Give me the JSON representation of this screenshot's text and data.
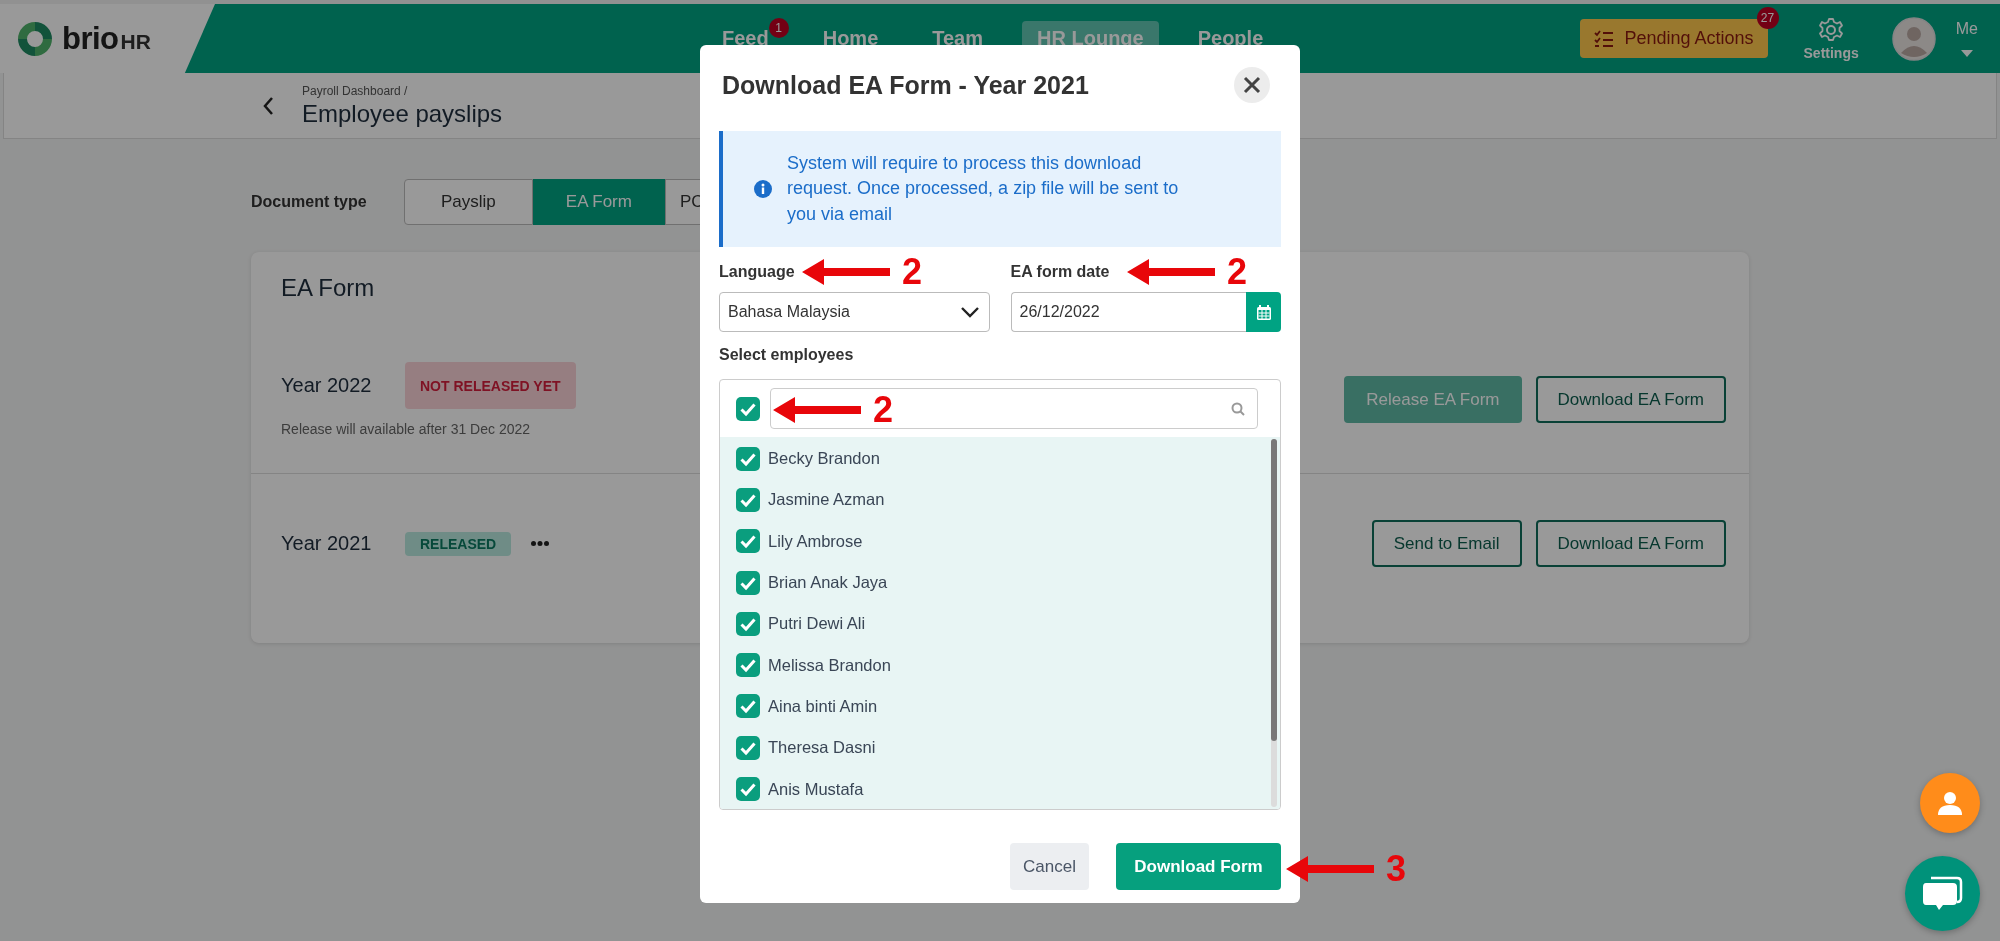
{
  "header": {
    "logo": {
      "name": "brio",
      "suffix": "HR"
    },
    "nav": [
      {
        "label": "Feed",
        "badge": "1",
        "selected": false
      },
      {
        "label": "Home",
        "selected": false
      },
      {
        "label": "Team",
        "selected": false
      },
      {
        "label": "HR Lounge",
        "selected": true
      },
      {
        "label": "People",
        "selected": false
      }
    ],
    "pending_actions": {
      "label": "Pending Actions",
      "badge": "27"
    },
    "settings": {
      "label": "Settings"
    },
    "user": {
      "label": "Me"
    }
  },
  "breadcrumb": {
    "parent": "Payroll Dashboard /",
    "title": "Employee payslips"
  },
  "document_type": {
    "label": "Document type",
    "tabs": [
      {
        "label": "Payslip",
        "selected": false
      },
      {
        "label": "EA Form",
        "selected": true
      },
      {
        "label": "PC",
        "selected": false
      }
    ]
  },
  "card": {
    "title": "EA Form",
    "rows": [
      {
        "year": "Year 2022",
        "status": "NOT RELEASED YET",
        "kind": "pending",
        "note": "Release will available after 31 Dec 2022",
        "has_menu": false,
        "buttons": [
          {
            "label": "Release EA Form",
            "kind": "filled",
            "disabled": true
          },
          {
            "label": "Download EA Form",
            "kind": "outline",
            "disabled": false
          }
        ]
      },
      {
        "year": "Year 2021",
        "status": "RELEASED",
        "kind": "released",
        "has_menu": true,
        "buttons": [
          {
            "label": "Send to Email",
            "kind": "outline",
            "disabled": false
          },
          {
            "label": "Download EA Form",
            "kind": "outline",
            "disabled": false
          }
        ]
      }
    ]
  },
  "modal": {
    "title": "Download EA Form - Year 2021",
    "info": "System will require to process this download request. Once processed, a zip file will be sent to you via email",
    "language": {
      "label": "Language",
      "value": "Bahasa Malaysia",
      "annotation": "2"
    },
    "date": {
      "label": "EA form date",
      "value": "26/12/2022",
      "annotation": "2"
    },
    "employees": {
      "label": "Select employees",
      "select_all": {
        "checked": true,
        "annotation": "2"
      },
      "items": [
        {
          "name": "Becky Brandon",
          "checked": true
        },
        {
          "name": "Jasmine Azman",
          "checked": true
        },
        {
          "name": "Lily Ambrose",
          "checked": true
        },
        {
          "name": "Brian Anak Jaya",
          "checked": true
        },
        {
          "name": "Putri Dewi Ali",
          "checked": true
        },
        {
          "name": "Melissa Brandon",
          "checked": true
        },
        {
          "name": "Aina binti Amin",
          "checked": true
        },
        {
          "name": "Theresa Dasni",
          "checked": true
        },
        {
          "name": "Anis Mustafa",
          "checked": true
        }
      ]
    },
    "buttons": [
      {
        "label": "Cancel",
        "kind": "secondary"
      },
      {
        "label": "Download Form",
        "kind": "primary",
        "annotation": "3"
      }
    ]
  }
}
